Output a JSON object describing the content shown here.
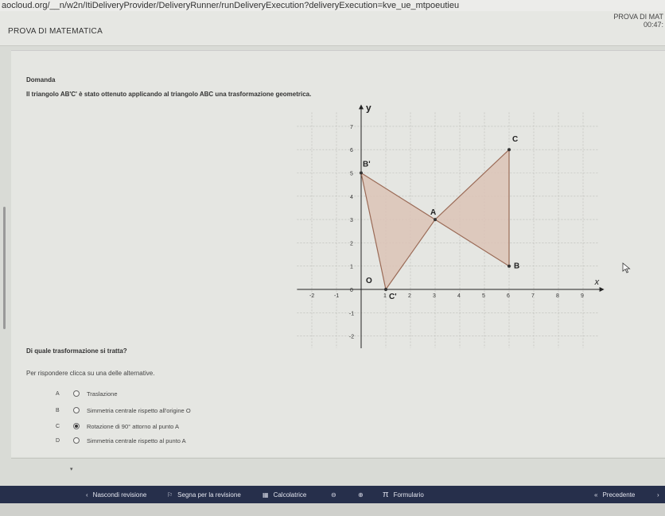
{
  "browser": {
    "url": "aocloud.org/__n/w2n/ItiDeliveryProvider/DeliveryRunner/runDeliveryExecution?deliveryExecution=kve_ue_mtpoeutieu"
  },
  "header": {
    "test_title": "PROVA DI MATEMATICA",
    "test_name_right": "PROVA DI MAT",
    "timer": "00:47:"
  },
  "question": {
    "heading": "Domanda",
    "stem": "Il triangolo AB'C' è stato ottenuto applicando al triangolo ABC una trasformazione geometrica.",
    "sub_question": "Di quale trasformazione si tratta?",
    "instructions": "Per rispondere clicca su una delle alternative.",
    "options": [
      {
        "letter": "A",
        "text": "Traslazione",
        "selected": false
      },
      {
        "letter": "B",
        "text": "Simmetria centrale rispetto all'origine O",
        "selected": false
      },
      {
        "letter": "C",
        "text": "Rotazione di 90° attorno al punto A",
        "selected": true
      },
      {
        "letter": "D",
        "text": "Simmetria centrale rispetto al punto A",
        "selected": false
      }
    ]
  },
  "graph": {
    "axis_x_label": "x",
    "axis_y_label": "y",
    "x_ticks": [
      "-2",
      "-1",
      "0",
      "1",
      "2",
      "3",
      "4",
      "5",
      "6",
      "7",
      "8",
      "9"
    ],
    "y_ticks": [
      "-2",
      "-1",
      "0",
      "1",
      "2",
      "3",
      "4",
      "5",
      "6",
      "7"
    ],
    "origin_label": "O",
    "points": [
      {
        "label": "A",
        "x": 3,
        "y": 3
      },
      {
        "label": "B",
        "x": 6,
        "y": 1
      },
      {
        "label": "C",
        "x": 6,
        "y": 6
      },
      {
        "label": "B'",
        "x": 0,
        "y": 5
      },
      {
        "label": "C'",
        "x": 1,
        "y": 0
      }
    ],
    "fill_color": "#dcc3b6",
    "stroke_color": "#9a6a56"
  },
  "toolbar": {
    "hide_review": "Nascondi revisione",
    "flag_review": "Segna per la revisione",
    "calculator": "Calcolatrice",
    "formulary": "Formulario",
    "previous": "Precedente"
  },
  "colors": {
    "toolbar_bg": "#262f4b",
    "page_bg": "#e5e6e2"
  }
}
